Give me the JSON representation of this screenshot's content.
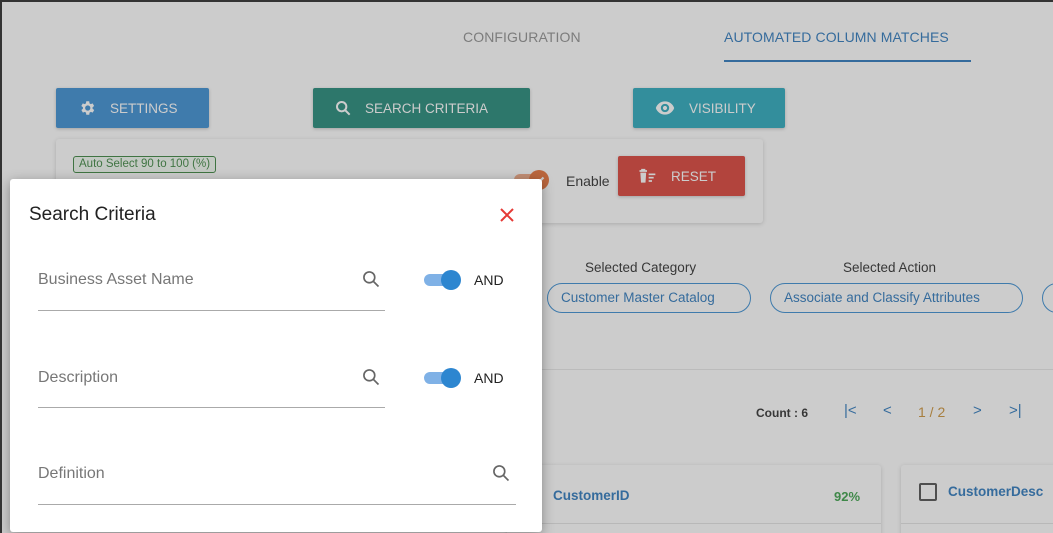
{
  "tabs": [
    {
      "label": "CONFIGURATION"
    },
    {
      "label": "AUTOMATED COLUMN MATCHES"
    }
  ],
  "toolbar": {
    "settings_label": "SETTINGS",
    "search_criteria_label": "SEARCH CRITERIA",
    "visibility_label": "VISIBILITY"
  },
  "auto_panel": {
    "auto_select_label": "Auto Select 90 to 100 (%)",
    "enable_label": "Enable",
    "reset_label": "RESET"
  },
  "selection": {
    "category_label": "Selected Category",
    "category_value": "Customer Master Catalog",
    "action_label": "Selected Action",
    "action_value": "Associate and Classify Attributes"
  },
  "pagination": {
    "count_label": "Count : 6",
    "first": "|<",
    "prev": "<",
    "page_info": "1 / 2",
    "next": ">",
    "last": ">|"
  },
  "results": [
    {
      "name": "CustomerID",
      "percent": "92%"
    },
    {
      "name": "CustomerDesc"
    }
  ],
  "dialog": {
    "title": "Search Criteria",
    "fields": [
      {
        "placeholder": "Business Asset Name",
        "operator": "AND"
      },
      {
        "placeholder": "Description",
        "operator": "AND"
      },
      {
        "placeholder": "Definition"
      }
    ]
  },
  "colors": {
    "settings_button": "#2d86d0",
    "search_button": "#12806f",
    "visibility_button": "#1ba3b8",
    "reset_button": "#d9352b",
    "accent_blue": "#1e6fb8",
    "close_red": "#e53935",
    "toggle_orange": "#e4672a"
  }
}
